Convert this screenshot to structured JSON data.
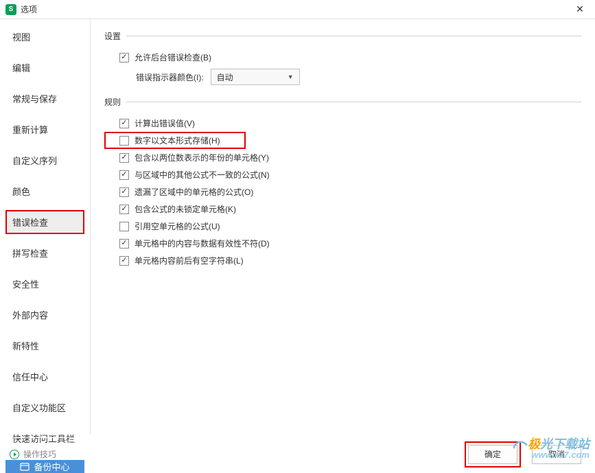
{
  "titlebar": {
    "title": "选项",
    "app_icon_letter": "S"
  },
  "sidebar": {
    "items": [
      {
        "label": "视图"
      },
      {
        "label": "编辑"
      },
      {
        "label": "常规与保存"
      },
      {
        "label": "重新计算"
      },
      {
        "label": "自定义序列"
      },
      {
        "label": "颜色"
      },
      {
        "label": "错误检查"
      },
      {
        "label": "拼写检查"
      },
      {
        "label": "安全性"
      },
      {
        "label": "外部内容"
      },
      {
        "label": "新特性"
      },
      {
        "label": "信任中心"
      },
      {
        "label": "自定义功能区"
      },
      {
        "label": "快速访问工具栏"
      }
    ],
    "active_index": 6,
    "backup_label": "备份中心"
  },
  "content": {
    "settings_section_title": "设置",
    "rules_section_title": "规则",
    "enable_bg_check_label": "允许后台错误检查(B)",
    "indicator_color_label": "错误指示器颜色(I):",
    "indicator_color_value": "自动",
    "rules": [
      {
        "checked": true,
        "label": "计算出错误值(V)"
      },
      {
        "checked": false,
        "label": "数字以文本形式存储(H)"
      },
      {
        "checked": true,
        "label": "包含以两位数表示的年份的单元格(Y)"
      },
      {
        "checked": true,
        "label": "与区域中的其他公式不一致的公式(N)"
      },
      {
        "checked": true,
        "label": "遗漏了区域中的单元格的公式(O)"
      },
      {
        "checked": true,
        "label": "包含公式的未锁定单元格(K)"
      },
      {
        "checked": false,
        "label": "引用空单元格的公式(U)"
      },
      {
        "checked": true,
        "label": "单元格中的内容与数据有效性不符(D)"
      },
      {
        "checked": true,
        "label": "单元格内容前后有空字符串(L)"
      }
    ]
  },
  "footer": {
    "tips_label": "操作技巧",
    "ok_label": "确定",
    "cancel_label": "取消"
  },
  "watermark": {
    "line1_prefix": "极",
    "line1_suffix": "光下载站",
    "line2": "www.xz7.com"
  }
}
